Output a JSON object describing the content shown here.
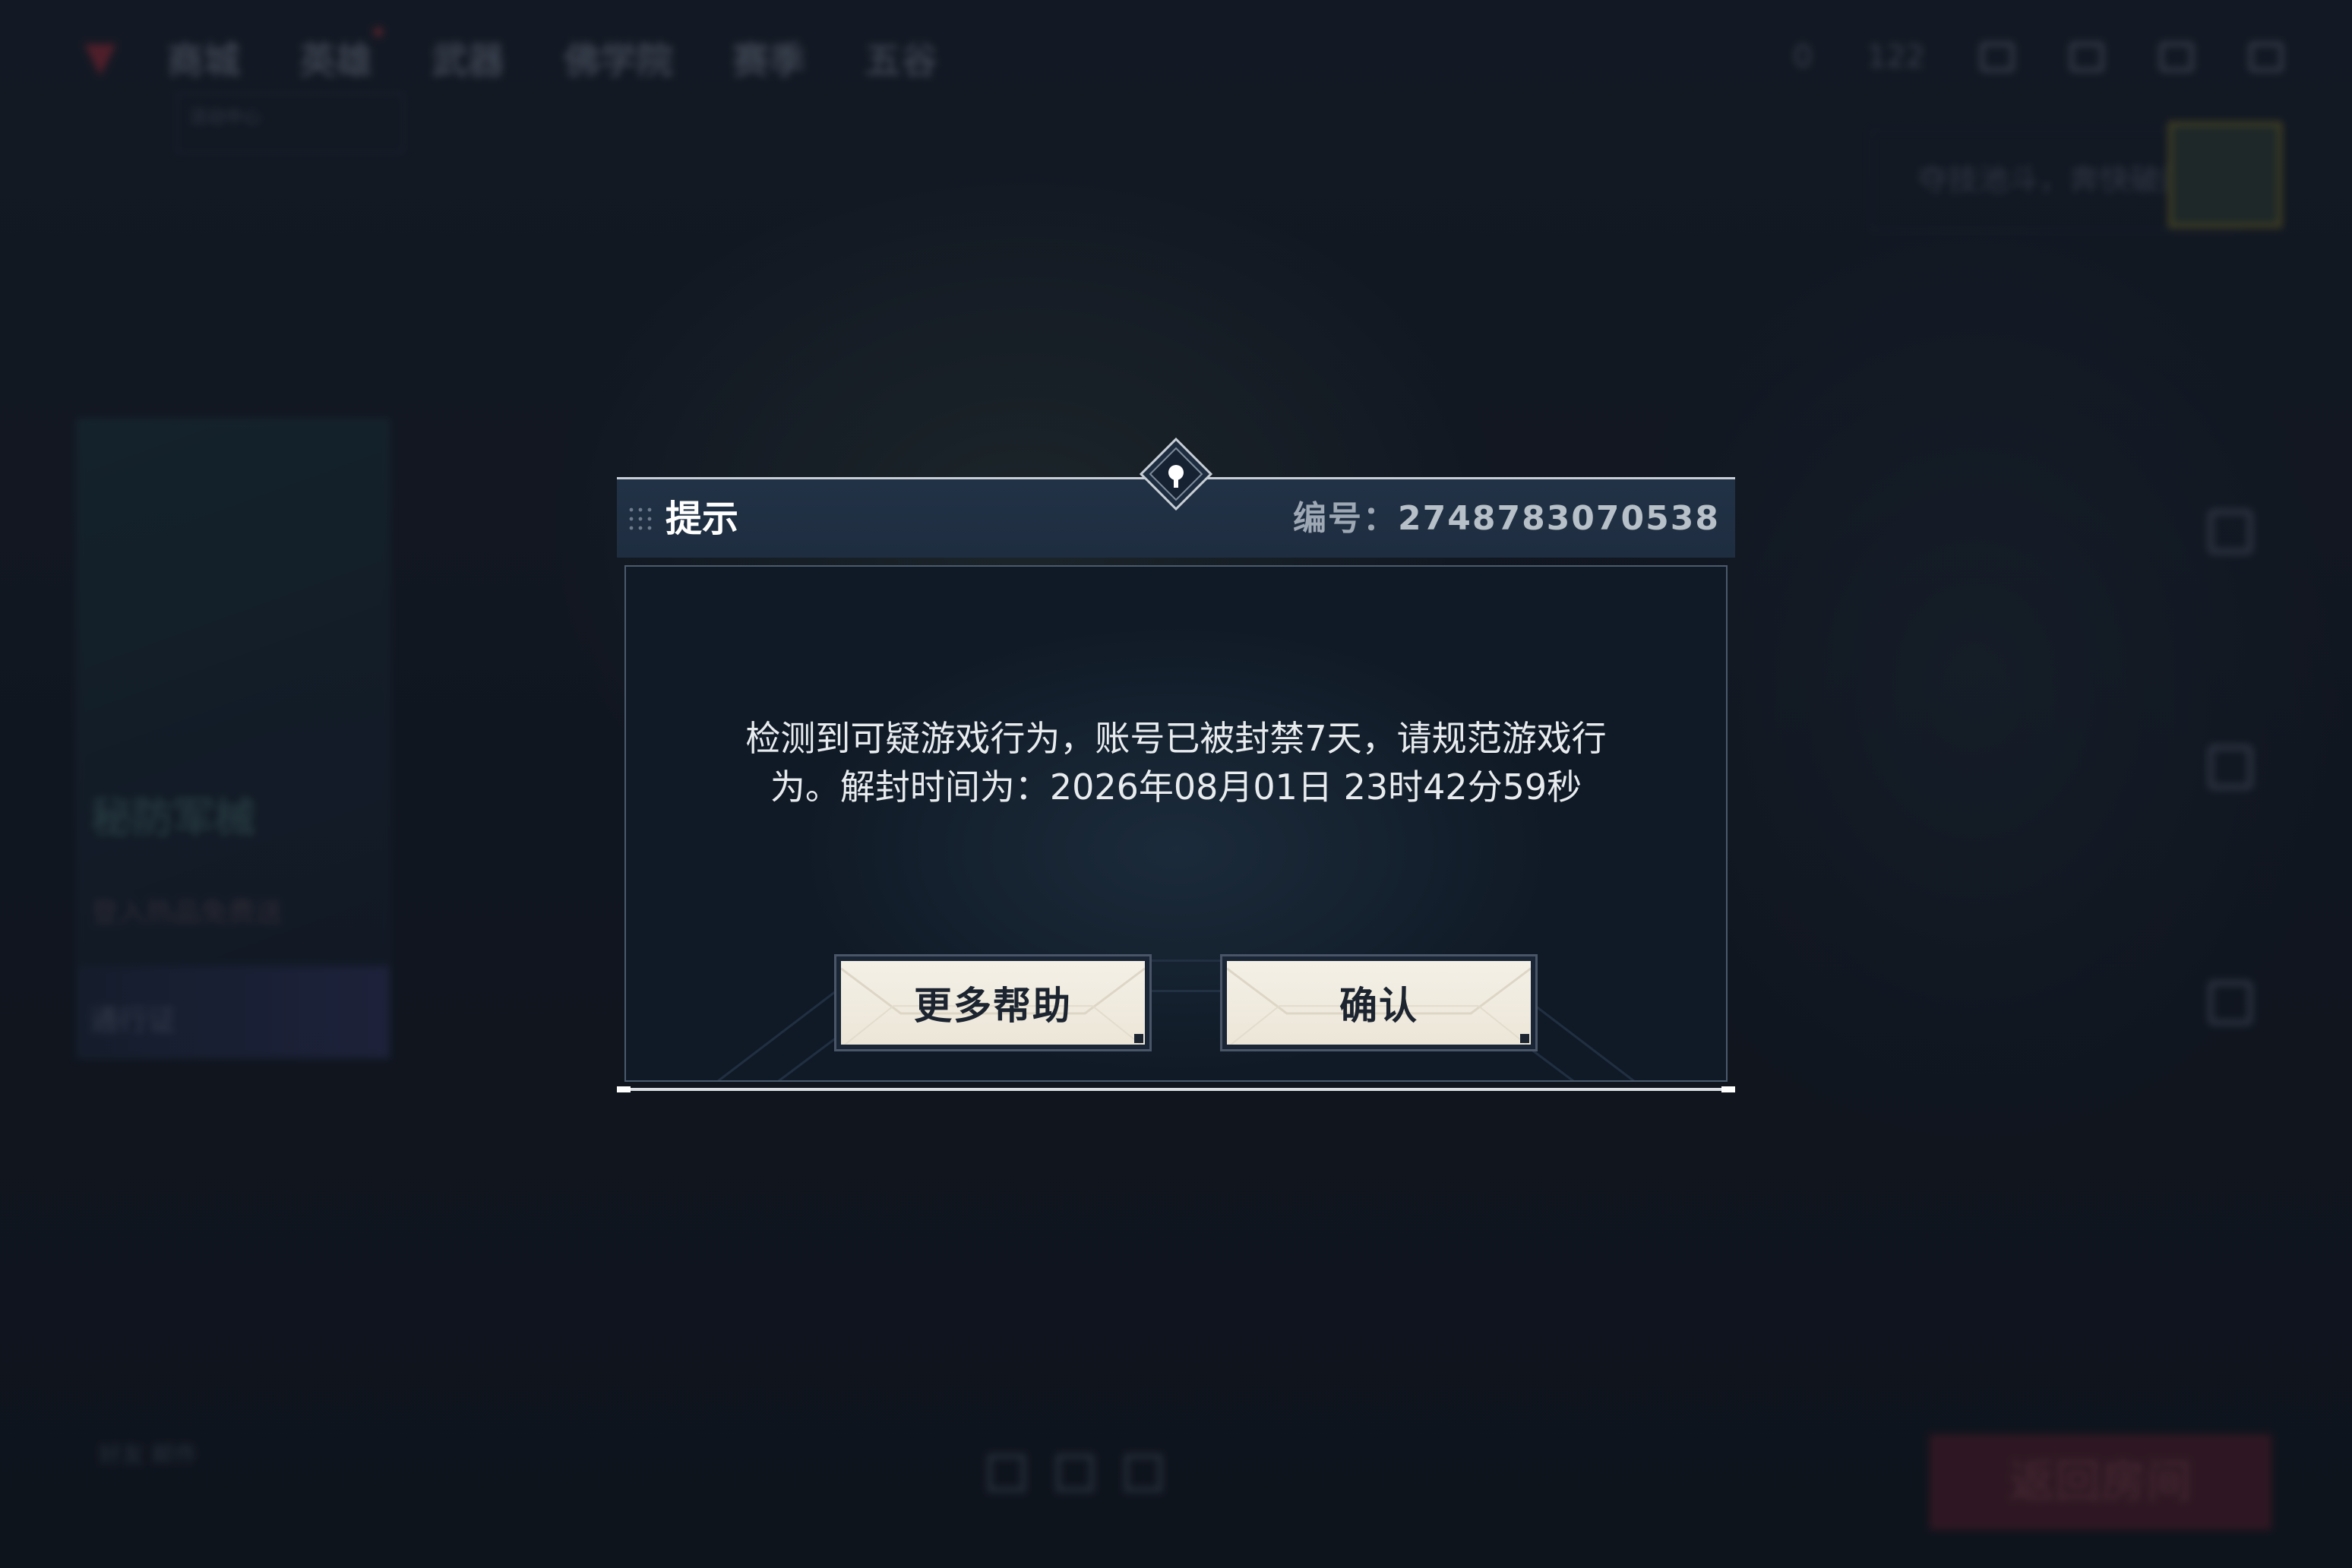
{
  "background": {
    "nav_items": [
      {
        "label": "商城",
        "dot": false
      },
      {
        "label": "英雄",
        "dot": true
      },
      {
        "label": "武器",
        "dot": false
      },
      {
        "label": "佛学院",
        "dot": false
      },
      {
        "label": "赛季",
        "dot": false
      },
      {
        "label": "五谷",
        "dot": false
      }
    ],
    "top_right": {
      "stat_a": "0",
      "stat_b": "122"
    },
    "sub_nav_text": "活动中心",
    "right_panel_text": "夺技池斗，奔快破门",
    "left_card": {
      "title": "秘防军械",
      "subtitle": "登入热品免费送",
      "bottom": "通行证"
    },
    "bottom_left_text": "好友  邮件",
    "bottom_right_button": "返回房间"
  },
  "dialog": {
    "title": "提示",
    "serial_label": "编号：",
    "serial_value": "2748783070538",
    "message_line1": "检测到可疑游戏行为，账号已被封禁7天，请规范游戏行",
    "message_line2": "为。解封时间为：2026年08月01日 23时42分59秒",
    "buttons": {
      "help": "更多帮助",
      "confirm": "确认"
    }
  },
  "colors": {
    "header_bg": "#223246",
    "body_bg": "#13202e",
    "button_face": "#f4f0e6",
    "accent_red": "#c03040"
  }
}
